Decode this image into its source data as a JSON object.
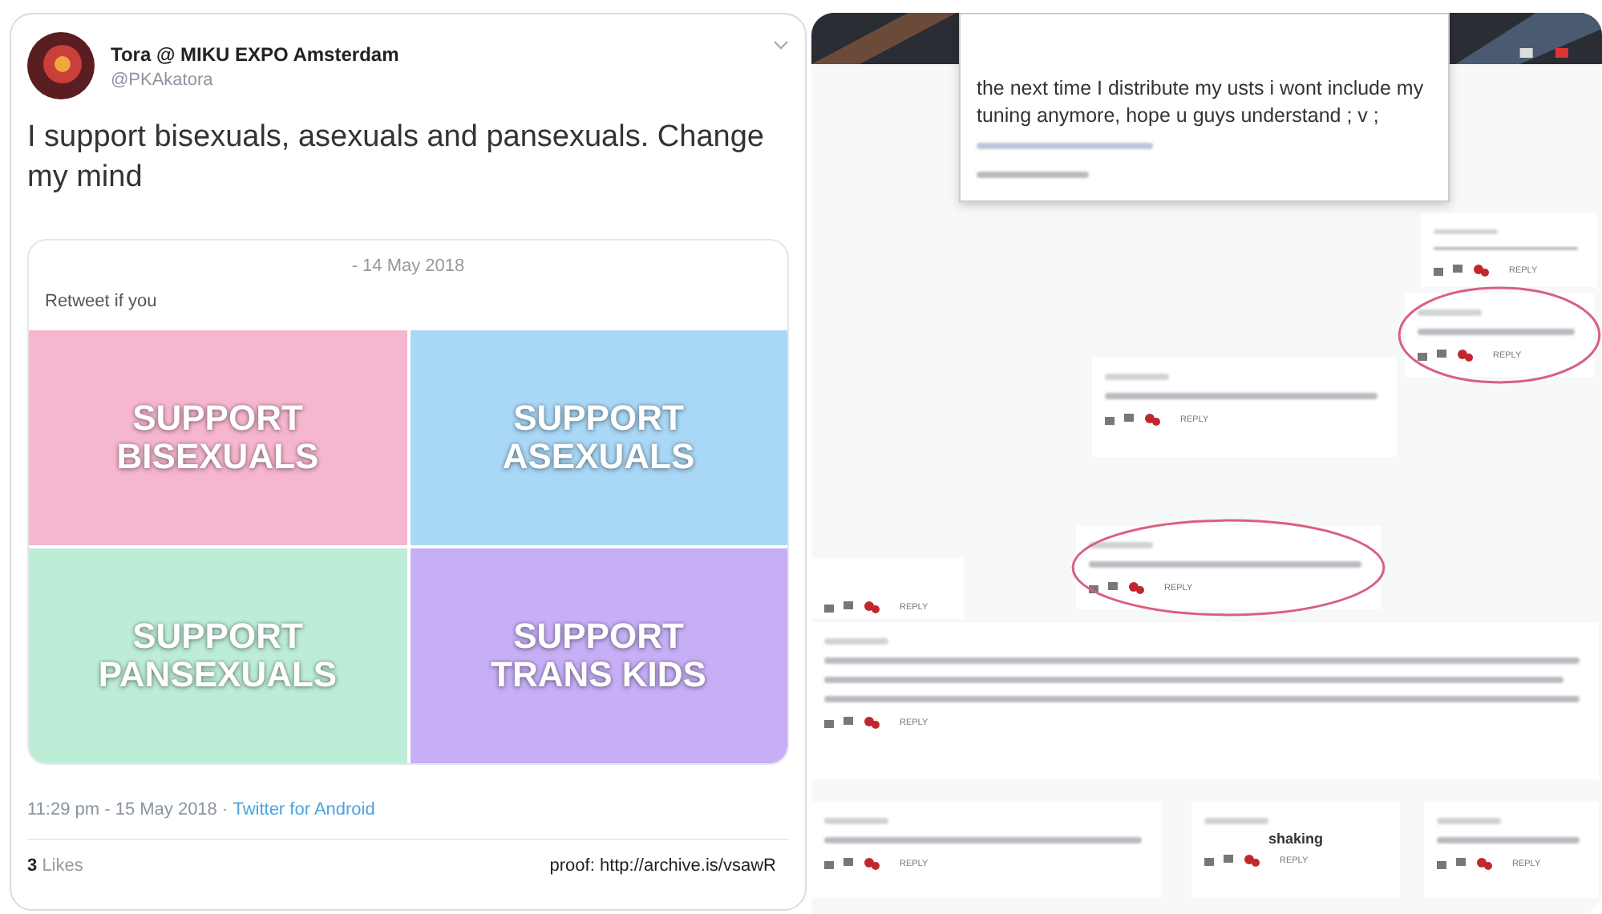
{
  "tweet": {
    "author": "Tora @ MIKU EXPO Amsterdam",
    "handle": "@PKAkatora",
    "text": "I support bisexuals, asexuals and pansexuals. Change my mind",
    "quote": {
      "date": "- 14 May 2018",
      "caption": "Retweet if you",
      "tiles": [
        {
          "label": "SUPPORT BISEXUALS",
          "color": "#f6b6cf"
        },
        {
          "label": "SUPPORT ASEXUALS",
          "color": "#a9d7f6"
        },
        {
          "label": "SUPPORT PANSEXUALS",
          "color": "#bdedd6"
        },
        {
          "label": "SUPPORT TRANS KIDS",
          "color": "#c7aff6"
        }
      ]
    },
    "timestamp": "11:29 pm - 15 May 2018 · ",
    "source": "Twitter for Android",
    "likes_count": "3",
    "likes_label": "Likes",
    "proof": "proof: http://archive.is/vsawR"
  },
  "collage": {
    "popup_tweet": {
      "text": "the next time I distribute my usts i wont include my tuning anymore, hope u guys understand ; v ;"
    },
    "comments": [
      {
        "reply": "REPLY",
        "circled": false
      },
      {
        "reply": "REPLY",
        "circled": true
      },
      {
        "reply": "REPLY",
        "circled": false
      },
      {
        "reply": "REPLY",
        "circled": true
      },
      {
        "reply": "REPLY",
        "circled": false
      },
      {
        "reply": "REPLY",
        "circled": false
      },
      {
        "reply": "REPLY",
        "circled": false
      },
      {
        "text": "shaking",
        "reply": "REPLY",
        "circled": false
      },
      {
        "reply": "REPLY",
        "circled": false
      }
    ]
  }
}
